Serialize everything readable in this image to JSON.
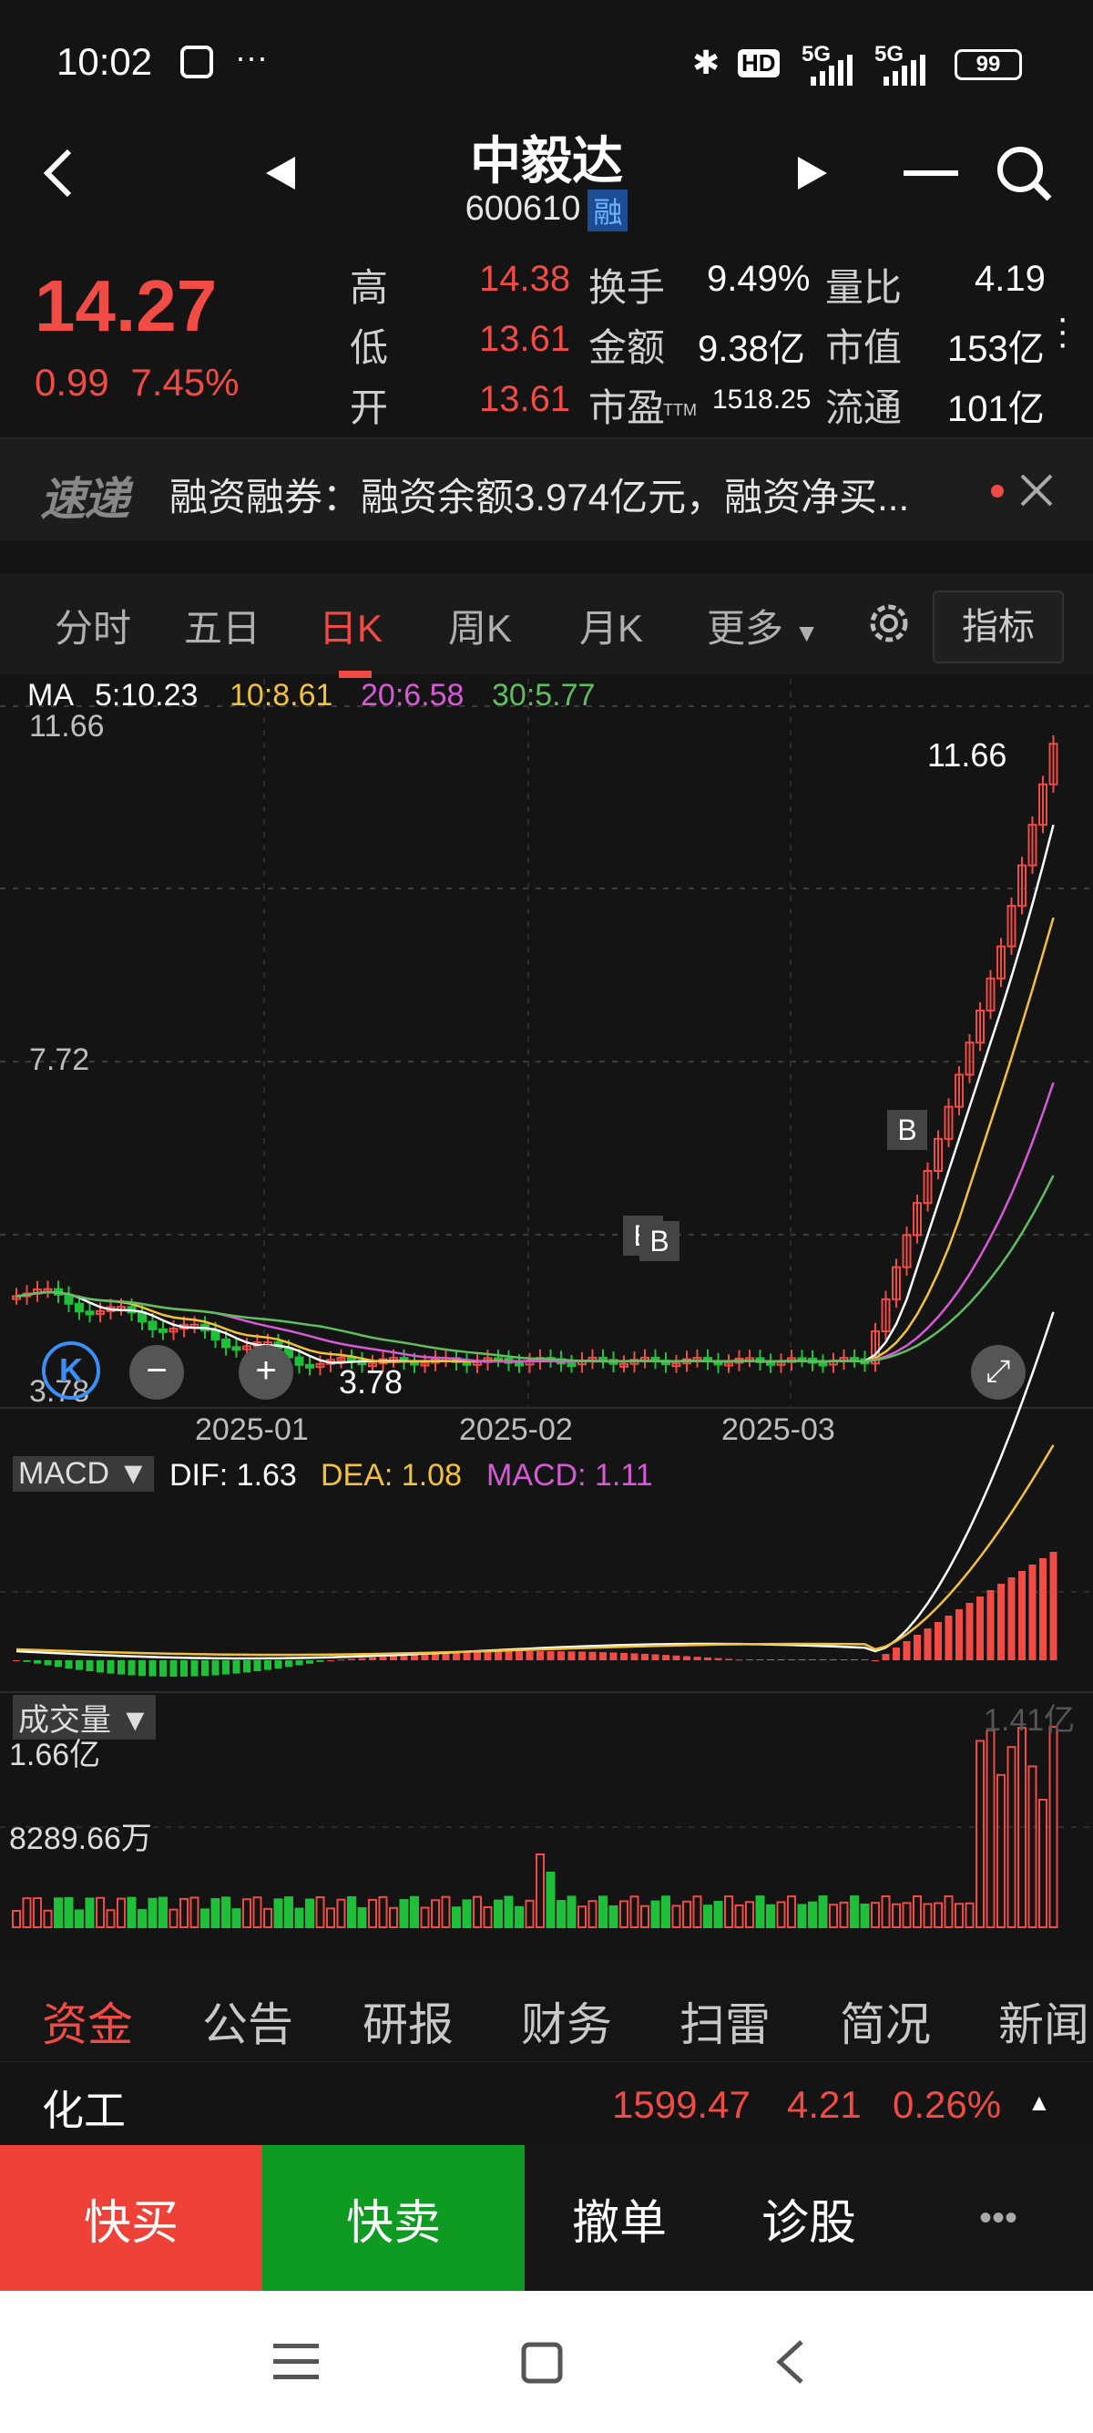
{
  "status_bar": {
    "time": "10:02",
    "dots": "···",
    "network": "5G",
    "network2": "5G",
    "hd": "HD",
    "battery": "99"
  },
  "header": {
    "title": "中毅达",
    "code": "600610",
    "tag": "融"
  },
  "quote": {
    "price": "14.27",
    "change": "0.99",
    "change_pct": "7.45%",
    "rows": [
      [
        {
          "label": "高",
          "value": "14.38",
          "color": "red"
        },
        {
          "label": "换手",
          "value": "9.49%",
          "color": "white"
        },
        {
          "label": "量比",
          "value": "4.19",
          "color": "white"
        }
      ],
      [
        {
          "label": "低",
          "value": "13.61",
          "color": "red"
        },
        {
          "label": "金额",
          "value": "9.38亿",
          "color": "white"
        },
        {
          "label": "市值",
          "value": "153亿",
          "color": "white"
        }
      ],
      [
        {
          "label": "开",
          "value": "13.61",
          "color": "red"
        },
        {
          "label": "市盈",
          "sub": "TTM",
          "value": "1518.25",
          "color": "white"
        },
        {
          "label": "流通",
          "value": "101亿",
          "color": "white"
        }
      ]
    ]
  },
  "news": {
    "logo": "速递",
    "text": "融资融券：融资余额3.974亿元，融资净买..."
  },
  "tabs": [
    "分时",
    "五日",
    "日K",
    "周K",
    "月K",
    "更多"
  ],
  "indicator_button": "指标",
  "ma": {
    "ma": "MA",
    "ma5": "5:10.23",
    "ma10": "10:8.61",
    "ma20": "20:6.58",
    "ma30": "30:5.77"
  },
  "axis": {
    "top": "11.66",
    "mid": "7.72",
    "bottom": "3.78",
    "max_label": "11.66",
    "min_label": "3.78",
    "dates": [
      "2025-01",
      "2025-02",
      "2025-03"
    ],
    "b_marks": [
      "B",
      "B",
      "B"
    ]
  },
  "macd": {
    "name": "MACD",
    "dif": "DIF: 1.63",
    "dea": "DEA: 1.08",
    "macd": "MACD: 1.11"
  },
  "volume": {
    "name": "成交量",
    "max": "1.41亿",
    "l1": "1.66亿",
    "l2": "8289.66万"
  },
  "info_tabs": [
    "资金",
    "公告",
    "研报",
    "财务",
    "扫雷",
    "简况",
    "新闻"
  ],
  "industry": {
    "name": "化工",
    "index": "1599.47",
    "change": "4.21",
    "pct": "0.26%"
  },
  "trade": {
    "buy": "快买",
    "sell": "快卖",
    "cancel": "撤单",
    "diagnose": "诊股",
    "more": "•••"
  },
  "colors": {
    "up": "#f04b45",
    "down": "#1fbf3a",
    "ma5": "#ffffff",
    "ma10": "#f3c23b",
    "ma20": "#d65ad6",
    "ma30": "#5fbf5f"
  }
}
